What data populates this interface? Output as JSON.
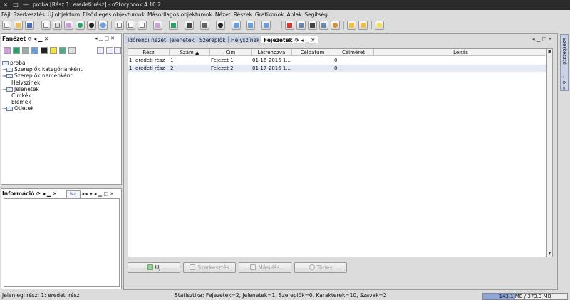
{
  "window": {
    "title": "proba [Rész 1: eredeti rész] - oStorybook 4.10.2",
    "close_glyph": "×",
    "restore_glyph": "□",
    "minimize_glyph": "—"
  },
  "menu": [
    "Fájl",
    "Szerkesztés",
    "Új objektum",
    "Elsődleges objektumok",
    "Másodlagos objektumok",
    "Nézet",
    "Részek",
    "Grafikonok",
    "Ablak",
    "Segítség"
  ],
  "toolbar_icons": [
    "new-file-icon",
    "open-icon",
    "save-icon",
    "chapter-icon",
    "scene-icon",
    "character-icon",
    "location-icon",
    "item-icon",
    "tag-icon",
    "chrono-view-icon",
    "book-view-icon",
    "manage-view-icon",
    "reading-view-icon",
    "memoria-icon",
    "chart-icon",
    "links-icon",
    "export-icon",
    "print-icon",
    "tools-icon",
    "preferences-icon",
    "back-icon",
    "forward-icon",
    "idea-icon"
  ],
  "left_panel": {
    "title": "Fanézet",
    "controls": "⟳  ◂ ▁ ✕",
    "tree": [
      {
        "label": "proba",
        "indent": 0,
        "folder": true,
        "expander": ""
      },
      {
        "label": "Szereplők kategóriánként",
        "indent": 1,
        "folder": true,
        "expander": "⊸"
      },
      {
        "label": "Szereplők nemenként",
        "indent": 1,
        "folder": true,
        "expander": "⊸"
      },
      {
        "label": "Helyszínek",
        "indent": 1,
        "folder": false,
        "expander": ""
      },
      {
        "label": "Jelenetek",
        "indent": 1,
        "folder": true,
        "expander": "⊸"
      },
      {
        "label": "Címkék",
        "indent": 1,
        "folder": false,
        "expander": ""
      },
      {
        "label": "Elemek",
        "indent": 1,
        "folder": false,
        "expander": ""
      },
      {
        "label": "Ötletek",
        "indent": 1,
        "folder": true,
        "expander": "⊸"
      }
    ]
  },
  "info_panel": {
    "title": "Információ",
    "tab2": "Na"
  },
  "tabs": [
    {
      "label": "Időrendi nézet",
      "active": false
    },
    {
      "label": "Jelenetek",
      "active": false
    },
    {
      "label": "Szereplők",
      "active": false
    },
    {
      "label": "Helyszínek",
      "active": false
    },
    {
      "label": "Fejezetek",
      "active": true
    }
  ],
  "table": {
    "columns": [
      "Rész",
      "Szám ▲",
      "Cím",
      "Létrehozva",
      "Céldátum",
      "Célméret",
      "Leírás"
    ],
    "rows": [
      [
        "1: eredeti rész",
        "1",
        "Fejezet 1",
        "01-16-2016 1...",
        "",
        "0",
        ""
      ],
      [
        "1: eredeti rész",
        "2",
        "Fejezet 2",
        "01-17-2016 1...",
        "",
        "0",
        ""
      ]
    ]
  },
  "buttons": {
    "new": "Új",
    "edit": "Szerkesztés",
    "copy": "Másolás",
    "delete": "Törlés"
  },
  "sidebar": {
    "label": "Szerkesztő"
  },
  "status": {
    "left": "Jelenlegi rész: 1: eredeti rész",
    "stats": "Statisztika: Fejezetek=2,  Jelenetek=1,  Szereplők=0,  Karakterek=10,  Szavak=2",
    "memory": "143.1 MB / 373.3 MB",
    "memory_fraction": 0.383
  },
  "colors": {
    "tab_inactive": "#c9d3e2",
    "selection": "#e4ebf6",
    "memory_bar": "#8ea6d8"
  }
}
